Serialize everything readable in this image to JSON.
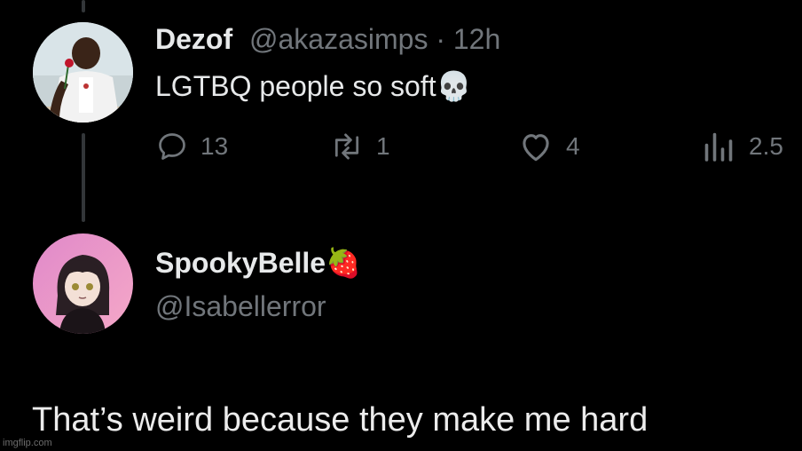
{
  "tweet": {
    "display_name": "Dezof",
    "handle": "@akazasimps",
    "separator": "·",
    "time": "12h",
    "text": "LGTBQ people so soft",
    "text_emoji": "💀",
    "actions": {
      "reply_count": "13",
      "retweet_count": "1",
      "like_count": "4",
      "views_count": "2.5"
    }
  },
  "reply": {
    "display_name": "SpookyBelle",
    "name_emoji": "🍓",
    "handle": "@Isabellerror",
    "text": "That’s weird because they make me hard"
  },
  "watermark": "imgflip.com",
  "colors": {
    "background": "#000000",
    "text": "#e7e9ea",
    "muted": "#71767b",
    "thread_line": "#333639"
  }
}
